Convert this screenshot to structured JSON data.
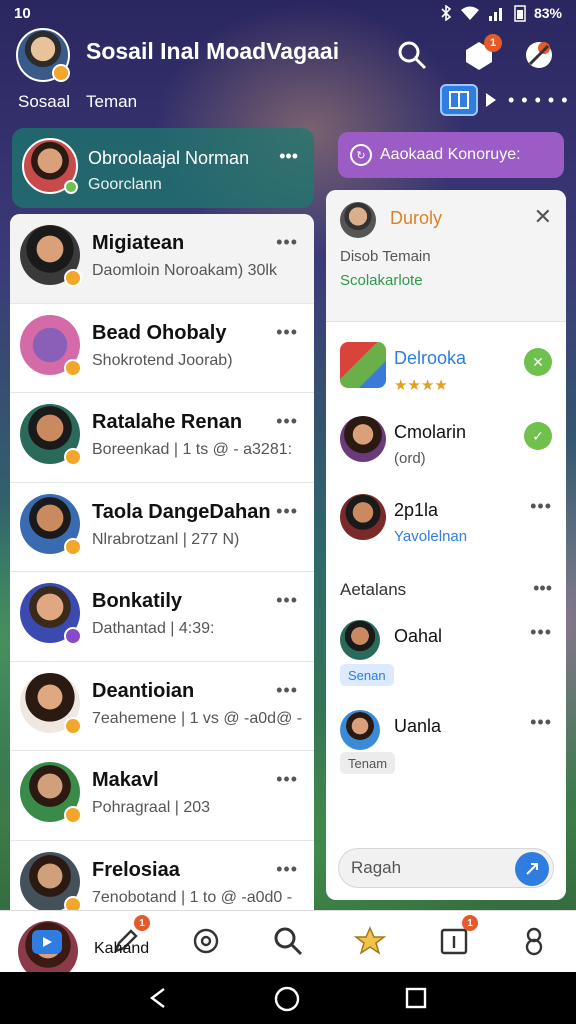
{
  "status_bar": {
    "time": "10",
    "battery": "83%"
  },
  "header": {
    "title": "Sosail Inal MoadVagaai",
    "sub_tab": "Sosaal",
    "sub_tab_2": "Teman",
    "notif_badge": "1",
    "dots": "• • • • •"
  },
  "group_card": {
    "title": "Obroolaajal Norman",
    "subtitle": "Goorclann"
  },
  "purple_button": {
    "label": "Aaokaad Konoruye:"
  },
  "chat_list": [
    {
      "name": "Migiatean",
      "preview": "Daomloin Noroakam) 30lk"
    },
    {
      "name": "Bead Ohobaly",
      "preview": "Shokrotend Joorab)"
    },
    {
      "name": "Ratalahe Renan",
      "preview": "Boreenkad | 1 ts @ - a3281:"
    },
    {
      "name": "Taola DangeDahan",
      "preview": "Nlrabrotzanl | 277 N)"
    },
    {
      "name": "Bonkatily",
      "preview": "Dathantad | 4:39:"
    },
    {
      "name": "Deantioian",
      "preview": "7eahemene | 1 vs @ -a0d@ -"
    },
    {
      "name": "Makavl",
      "preview": "Pohragraal | 203"
    },
    {
      "name": "Frelosiaa",
      "preview": "7enobotand | 1 to @ -a0d0 -"
    }
  ],
  "right_panel": {
    "head_name": "Duroly",
    "head_sub": "Disob Temain",
    "head_status": "Scolakarlote",
    "items": [
      {
        "name": "Delrooka",
        "sub": "★★★★"
      },
      {
        "name": "Cmolarin",
        "sub": "(ord)"
      },
      {
        "name": "2p1la",
        "sub": "Yavolelnan"
      }
    ],
    "section_label": "Aetalans",
    "section_items": [
      {
        "name": "Oahal",
        "pill": "Senan"
      },
      {
        "name": "Uanla",
        "pill": "Tenam"
      }
    ],
    "input_placeholder": "Ragah"
  },
  "tab_bar": {
    "me_label": "Kahand",
    "badge_1": "1",
    "badge_2": "1"
  },
  "colors": {
    "accent": "#2f7de1",
    "purple": "#9b5cc6",
    "green": "#6fc04d",
    "orange": "#f2a62a"
  }
}
